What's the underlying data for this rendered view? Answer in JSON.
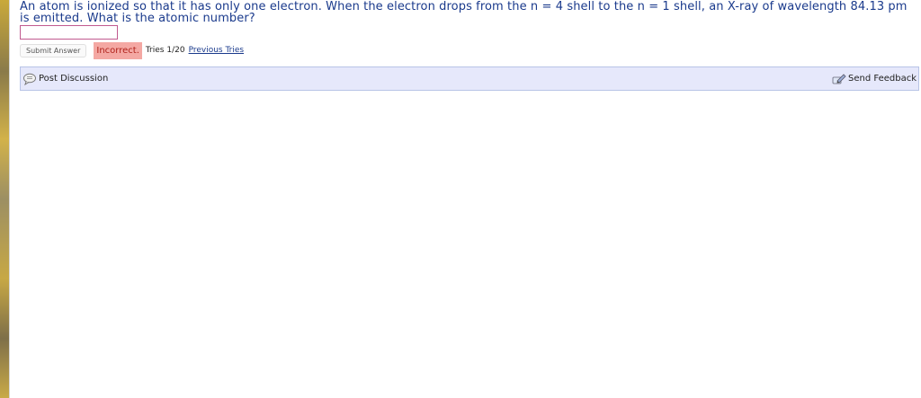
{
  "question": {
    "text": "An atom is ionized so that it has only one electron. When the electron drops from the n = 4 shell to the n = 1 shell, an X-ray of wavelength 84.13 pm is emitted. What is the atomic number?"
  },
  "answer": {
    "value": ""
  },
  "submission": {
    "submit_label": "Submit Answer",
    "status": "Incorrect.",
    "tries": "Tries 1/20",
    "previous_tries_label": "Previous Tries"
  },
  "discussion_bar": {
    "post_label": "Post Discussion",
    "feedback_label": "Send Feedback"
  },
  "icons": {
    "post": "speech-bubble-icon",
    "feedback": "pen-feedback-icon"
  },
  "colors": {
    "question_text": "#1a3a8c",
    "status_bg": "#f4a8a3",
    "status_text": "#b0221b",
    "bar_bg": "#e6e8fb",
    "bar_border": "#b8c4e6",
    "input_border": "#c15a8f"
  }
}
